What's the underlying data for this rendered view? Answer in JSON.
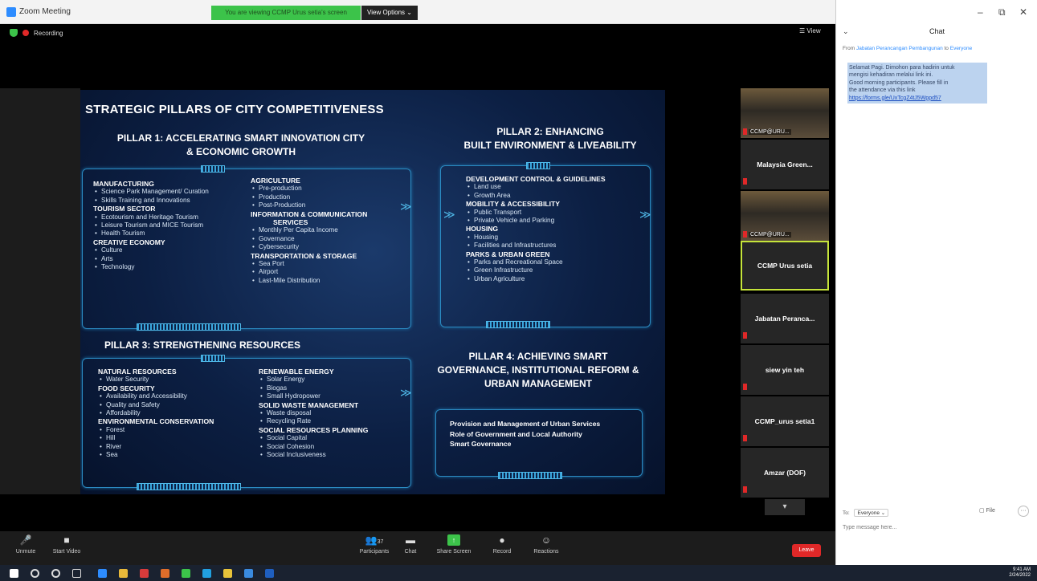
{
  "window": {
    "title": "Zoom Meeting",
    "share_banner": "You are viewing CCMP Urus setia's screen",
    "view_options": "View Options ⌄"
  },
  "meeting": {
    "recording": "Recording",
    "view": "☰ View"
  },
  "slide": {
    "header": "STRATEGIC PILLARS OF CITY COMPETITIVENESS",
    "pillar1": {
      "line1": "PILLAR 1: ACCELERATING SMART INNOVATION CITY",
      "line2": "& ECONOMIC GROWTH"
    },
    "pillar2": {
      "line1": "PILLAR 2: ENHANCING",
      "line2": "BUILT ENVIRONMENT & LIVEABILITY"
    },
    "pillar3": {
      "line1": "PILLAR 3: STRENGTHENING RESOURCES"
    },
    "pillar4": {
      "line1": "PILLAR 4: ACHIEVING SMART",
      "line2": "GOVERNANCE, INSTITUTIONAL REFORM &",
      "line3": "URBAN MANAGEMENT"
    },
    "p1_left": {
      "manufacturing": {
        "title": "MANUFACTURING",
        "items": [
          "Science Park Management/ Curation",
          "Skills Training and Innovations"
        ]
      },
      "tourism": {
        "title": "TOURISM SECTOR",
        "items": [
          "Ecotourism and Heritage Tourism",
          "Leisure Tourism and MICE Tourism",
          "Health Tourism"
        ]
      },
      "creative": {
        "title": "CREATIVE ECONOMY",
        "items": [
          "Culture",
          "Arts",
          "Technology"
        ]
      }
    },
    "p1_right": {
      "agriculture": {
        "title": "AGRICULTURE",
        "items": [
          "Pre-production",
          "Production",
          "Post-Production"
        ]
      },
      "ict": {
        "title1": "INFORMATION & COMMUNICATION",
        "title2": "SERVICES",
        "items": [
          "Monthly Per Capita Income",
          "Governance",
          "Cybersecurity"
        ]
      },
      "transport": {
        "title": "TRANSPORTATION & STORAGE",
        "items": [
          "Sea Port",
          "Airport",
          "Last-Mile Distribution"
        ]
      }
    },
    "p2": {
      "dev": {
        "title": "DEVELOPMENT CONTROL & GUIDELINES",
        "items": [
          "Land use",
          "Growth Area"
        ]
      },
      "mobility": {
        "title": "MOBILITY & ACCESSIBILITY",
        "items": [
          "Public Transport",
          "Private Vehicle and Parking"
        ]
      },
      "housing": {
        "title": "HOUSING",
        "items": [
          "Housing",
          "Facilities and Infrastructures"
        ]
      },
      "parks": {
        "title": "PARKS & URBAN GREEN",
        "items": [
          "Parks and Recreational Space",
          "Green Infrastructure",
          "Urban Agriculture"
        ]
      }
    },
    "p3_left": {
      "natural": {
        "title": "NATURAL RESOURCES",
        "items": [
          "Water Security"
        ]
      },
      "food": {
        "title": "FOOD SECURITY",
        "items": [
          "Availability and Accessibility",
          "Quality and Safety",
          "Affordability"
        ]
      },
      "env": {
        "title": "ENVIRONMENTAL CONSERVATION",
        "items": [
          "Forest",
          "Hill",
          "River",
          "Sea"
        ]
      }
    },
    "p3_right": {
      "renew": {
        "title": "RENEWABLE ENERGY",
        "items": [
          "Solar Energy",
          "Biogas",
          "Small Hydropower"
        ]
      },
      "waste": {
        "title": "SOLID WASTE MANAGEMENT",
        "items": [
          "Waste disposal",
          "Recycling Rate"
        ]
      },
      "social": {
        "title": "SOCIAL RESOURCES PLANNING",
        "items": [
          "Social Capital",
          "Social Cohesion",
          "Social Inclusiveness"
        ]
      }
    },
    "p4_lines": [
      "Provision and Management of Urban Services",
      "Role of Government and Local Authority",
      "Smart Governance"
    ]
  },
  "participants_strip": [
    {
      "name": "CCMP@URU..."
    },
    {
      "name": "Malaysia Green..."
    },
    {
      "name": "CCMP@URU..."
    },
    {
      "name": "CCMP Urus setia"
    },
    {
      "name": "Jabatan Peranca..."
    },
    {
      "name": "siew yin teh"
    },
    {
      "name": "CCMP_urus setia1"
    },
    {
      "name": "Amzar (DOF)"
    }
  ],
  "toolbar": {
    "unmute": "Unmute",
    "start_video": "Start Video",
    "participants": "Participants",
    "participant_count": "37",
    "chat": "Chat",
    "share_screen": "Share Screen",
    "record": "Record",
    "reactions": "Reactions",
    "leave": "Leave"
  },
  "chat": {
    "title": "Chat",
    "from_prefix": "From",
    "from_name": "Jabatan Perancangan Pembangunan",
    "to_word": "to",
    "to_name": "Everyone",
    "message": [
      "Selamat Pagi. Dimohon para hadirin untuk",
      "mengisi kehadiran melalui link ini.",
      "Good morning participants. Please fill in",
      "the attendance via this link"
    ],
    "link": "https://forms.gle/UxTcgZ4tJ5Wppd57",
    "to_label": "To:",
    "to_select": "Everyone ⌄",
    "file": "File",
    "placeholder": "Type message here..."
  },
  "taskbar": {
    "time": "9:41 AM",
    "date": "2/24/2022"
  }
}
